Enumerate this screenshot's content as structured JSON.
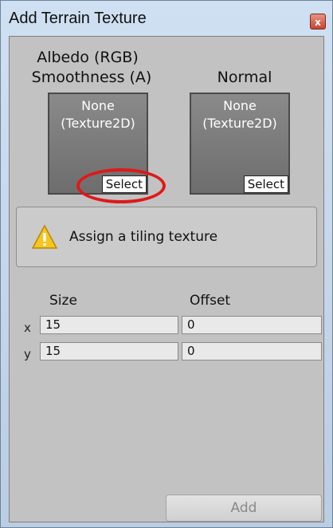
{
  "window": {
    "title": "Add Terrain Texture",
    "close_glyph": "x"
  },
  "albedo": {
    "label_line1": "Albedo (RGB)",
    "label_line2": "Smoothness (A)",
    "slot_text": "None\n(Texture2D)",
    "select_label": "Select"
  },
  "normal": {
    "label": "Normal",
    "slot_text": "None\n(Texture2D)",
    "select_label": "Select"
  },
  "help": {
    "icon": "warning-icon",
    "message": "Assign a tiling texture"
  },
  "tiling": {
    "size_header": "Size",
    "offset_header": "Offset",
    "x_label": "x",
    "y_label": "y",
    "size_x": "15",
    "size_y": "15",
    "offset_x": "0",
    "offset_y": "0"
  },
  "footer": {
    "add_label": "Add"
  },
  "colors": {
    "highlight": "#e01818",
    "warning": "#f7c51d"
  }
}
